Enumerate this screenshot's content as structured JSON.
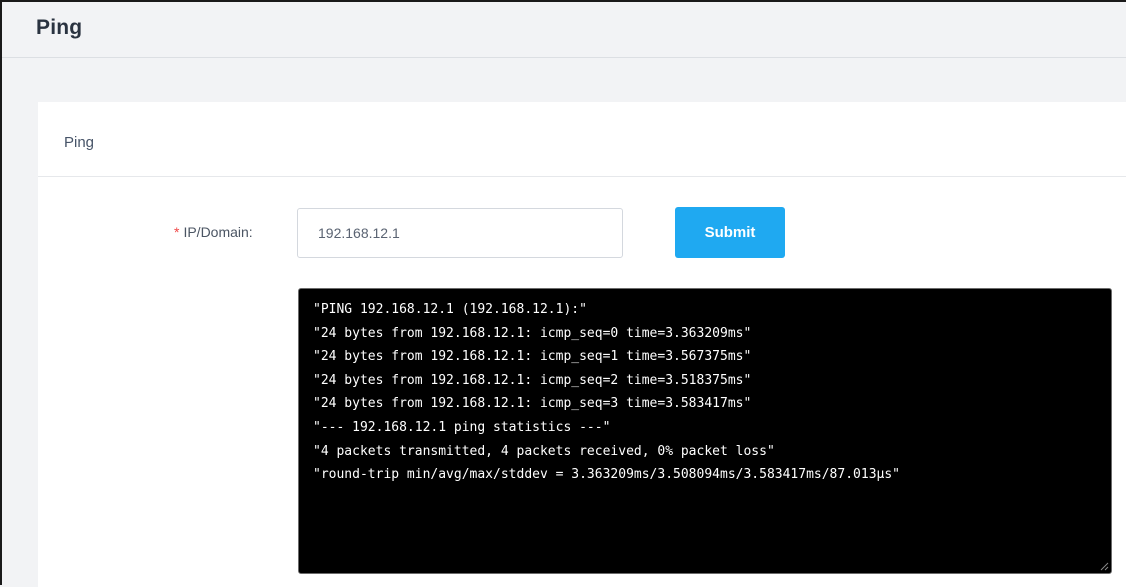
{
  "page": {
    "title": "Ping"
  },
  "card": {
    "title": "Ping"
  },
  "form": {
    "required_marker": "*",
    "ip_label": "IP/Domain:",
    "ip_value": "192.168.12.1",
    "submit_label": "Submit"
  },
  "output": {
    "lines": [
      "\"PING 192.168.12.1 (192.168.12.1):\"",
      "\"24 bytes from 192.168.12.1: icmp_seq=0 time=3.363209ms\"",
      "\"24 bytes from 192.168.12.1: icmp_seq=1 time=3.567375ms\"",
      "\"24 bytes from 192.168.12.1: icmp_seq=2 time=3.518375ms\"",
      "\"24 bytes from 192.168.12.1: icmp_seq=3 time=3.583417ms\"",
      "\"--- 192.168.12.1 ping statistics ---\"",
      "\"4 packets transmitted, 4 packets received, 0% packet loss\"",
      "\"round-trip min/avg/max/stddev = 3.363209ms/3.508094ms/3.583417ms/87.013µs\""
    ]
  },
  "colors": {
    "accent": "#1fa9f1",
    "required": "#f04848",
    "console_bg": "#000000"
  },
  "icons": {
    "resize_handle": "resize-grip-icon"
  }
}
